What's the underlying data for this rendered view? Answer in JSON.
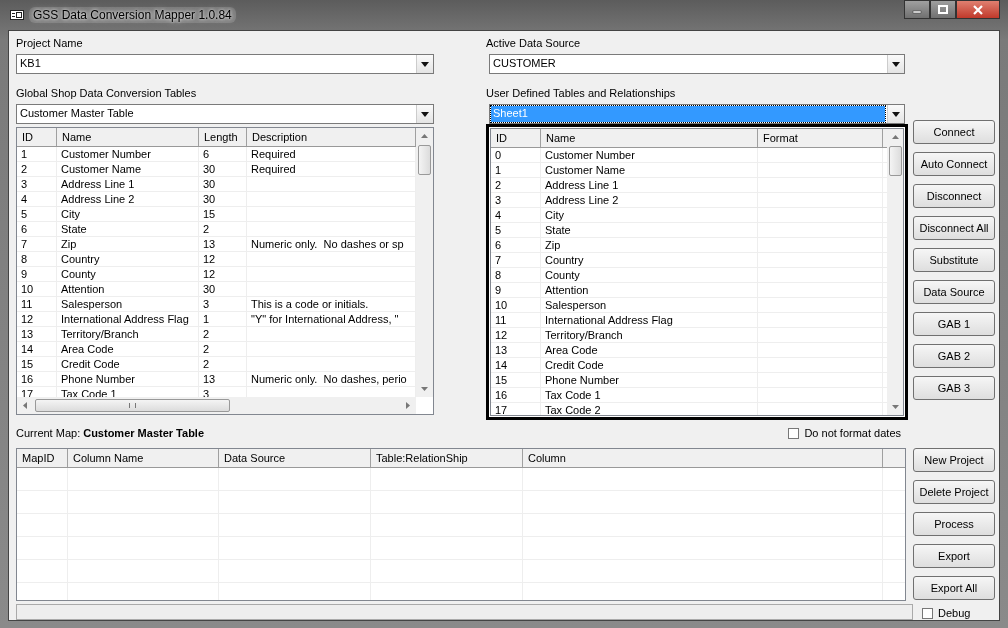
{
  "window": {
    "title": "GSS Data Conversion Mapper 1.0.84"
  },
  "project": {
    "label": "Project Name",
    "value": "KB1"
  },
  "active_source": {
    "label": "Active Data Source",
    "value": "CUSTOMER"
  },
  "gs_tables": {
    "label": "Global Shop Data Conversion Tables",
    "value": "Customer Master Table"
  },
  "gs_table": {
    "columns": [
      "ID",
      "Name",
      "Length",
      "Description"
    ],
    "rows": [
      [
        "1",
        "Customer Number",
        "6",
        "Required"
      ],
      [
        "2",
        "Customer Name",
        "30",
        "Required"
      ],
      [
        "3",
        "Address Line 1",
        "30",
        ""
      ],
      [
        "4",
        "Address Line 2",
        "30",
        ""
      ],
      [
        "5",
        "City",
        "15",
        ""
      ],
      [
        "6",
        "State",
        "2",
        ""
      ],
      [
        "7",
        "Zip",
        "13",
        "Numeric only.  No dashes or sp"
      ],
      [
        "8",
        "Country",
        "12",
        ""
      ],
      [
        "9",
        "County",
        "12",
        ""
      ],
      [
        "10",
        "Attention",
        "30",
        ""
      ],
      [
        "11",
        "Salesperson",
        "3",
        "This is a code or initials."
      ],
      [
        "12",
        "International Address Flag",
        "1",
        "\"Y\" for International Address, \""
      ],
      [
        "13",
        "Territory/Branch",
        "2",
        ""
      ],
      [
        "14",
        "Area Code",
        "2",
        ""
      ],
      [
        "15",
        "Credit Code",
        "2",
        ""
      ],
      [
        "16",
        "Phone Number",
        "13",
        "Numeric only.  No dashes, perio"
      ],
      [
        "17",
        "Tax Code 1",
        "3",
        ""
      ]
    ]
  },
  "user_tables": {
    "label": "User Defined Tables and Relationships",
    "value": "Sheet1",
    "selected": true
  },
  "user_table": {
    "columns": [
      "ID",
      "Name",
      "Format"
    ],
    "rows": [
      [
        "0",
        "Customer Number"
      ],
      [
        "1",
        "Customer Name"
      ],
      [
        "2",
        "Address Line 1"
      ],
      [
        "3",
        "Address Line 2"
      ],
      [
        "4",
        "City"
      ],
      [
        "5",
        "State"
      ],
      [
        "6",
        "Zip"
      ],
      [
        "7",
        "Country"
      ],
      [
        "8",
        "County"
      ],
      [
        "9",
        "Attention"
      ],
      [
        "10",
        "Salesperson"
      ],
      [
        "11",
        "International Address Flag"
      ],
      [
        "12",
        "Territory/Branch"
      ],
      [
        "13",
        "Area Code"
      ],
      [
        "14",
        "Credit Code"
      ],
      [
        "15",
        "Phone Number"
      ],
      [
        "16",
        "Tax Code 1"
      ],
      [
        "17",
        "Tax Code 2"
      ]
    ]
  },
  "side_buttons": [
    "Connect",
    "Auto Connect",
    "Disconnect",
    "Disconnect All",
    "Substitute",
    "Data Source",
    "GAB 1",
    "GAB 2",
    "GAB 3"
  ],
  "current_map": {
    "label": "Current Map:",
    "value": "Customer Master Table"
  },
  "do_not_format_dates": {
    "label": "Do not format dates",
    "checked": false
  },
  "map_table": {
    "columns": [
      "MapID",
      "Column Name",
      "Data Source",
      "Table:RelationShip",
      "Column"
    ]
  },
  "bottom_buttons": [
    "New Project",
    "Delete Project",
    "Process",
    "Export",
    "Export All"
  ],
  "debug": {
    "label": "Debug",
    "checked": false
  }
}
